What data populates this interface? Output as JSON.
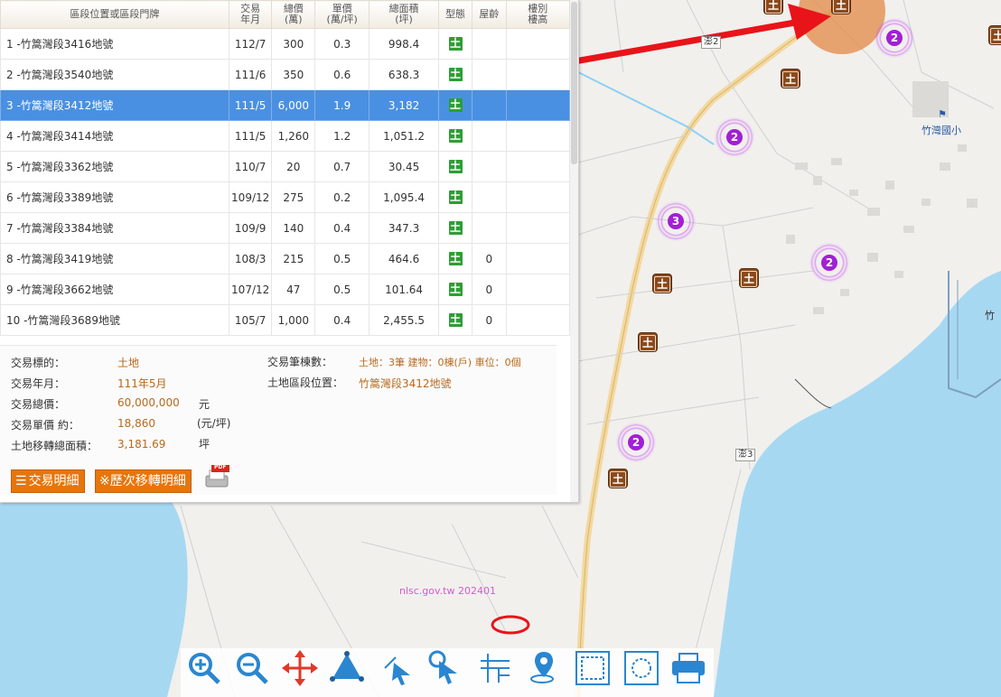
{
  "table": {
    "headers": {
      "address": "區段位置或區段門牌",
      "date_l1": "交易",
      "date_l2": "年月",
      "total_l1": "總價",
      "total_l2": "(萬)",
      "unit_l1": "單價",
      "unit_l2": "(萬/坪)",
      "area_l1": "總面積",
      "area_l2": "(坪)",
      "type": "型態",
      "age": "屋齡",
      "floor_l1": "樓別",
      "floor_l2": "樓高"
    },
    "rows": [
      {
        "address": "1 -竹篙灣段3416地號",
        "date": "112/7",
        "total": "300",
        "unit": "0.3",
        "area": "998.4",
        "type": "土",
        "age": "",
        "floor": ""
      },
      {
        "address": "2 -竹篙灣段3540地號",
        "date": "111/6",
        "total": "350",
        "unit": "0.6",
        "area": "638.3",
        "type": "土",
        "age": "",
        "floor": ""
      },
      {
        "address": "3 -竹篙灣段3412地號",
        "date": "111/5",
        "total": "6,000",
        "unit": "1.9",
        "area": "3,182",
        "type": "土",
        "age": "",
        "floor": ""
      },
      {
        "address": "4 -竹篙灣段3414地號",
        "date": "111/5",
        "total": "1,260",
        "unit": "1.2",
        "area": "1,051.2",
        "type": "土",
        "age": "",
        "floor": ""
      },
      {
        "address": "5 -竹篙灣段3362地號",
        "date": "110/7",
        "total": "20",
        "unit": "0.7",
        "area": "30.45",
        "type": "土",
        "age": "",
        "floor": ""
      },
      {
        "address": "6 -竹篙灣段3389地號",
        "date": "109/12",
        "total": "275",
        "unit": "0.2",
        "area": "1,095.4",
        "type": "土",
        "age": "",
        "floor": ""
      },
      {
        "address": "7 -竹篙灣段3384地號",
        "date": "109/9",
        "total": "140",
        "unit": "0.4",
        "area": "347.3",
        "type": "土",
        "age": "",
        "floor": ""
      },
      {
        "address": "8 -竹篙灣段3419地號",
        "date": "108/3",
        "total": "215",
        "unit": "0.5",
        "area": "464.6",
        "type": "土",
        "age": "0",
        "floor": ""
      },
      {
        "address": "9 -竹篙灣段3662地號",
        "date": "107/12",
        "total": "47",
        "unit": "0.5",
        "area": "101.64",
        "type": "土",
        "age": "0",
        "floor": ""
      },
      {
        "address": "10 -竹篙灣段3689地號",
        "date": "105/7",
        "total": "1,000",
        "unit": "0.4",
        "area": "2,455.5",
        "type": "土",
        "age": "0",
        "floor": ""
      }
    ]
  },
  "details": {
    "target_label": "交易標的：",
    "target_value": "土地",
    "date_label": "交易年月：",
    "date_value": "111年5月",
    "total_label": "交易總價：",
    "total_value": "60,000,000",
    "total_unit": "元",
    "unit_label": "交易單價 約：",
    "unit_value": "18,860",
    "unit_unit": "(元/坪)",
    "area_label": "土地移轉總面積：",
    "area_value": "3,181.69",
    "area_unit": "坪",
    "count_label": "交易筆棟數：",
    "count_value": "土地：3筆 建物：0棟(戶) 車位：0個",
    "location_label": "土地區段位置：",
    "location_value": "竹篙灣段3412地號"
  },
  "buttons": {
    "detail": "交易明細",
    "history": "※歷次移轉明細",
    "pdf_badge": "PDF"
  },
  "map": {
    "watermark": "nlsc.gov.tw 202401",
    "place_label": "竹灣國小",
    "road_label_1": "澎2",
    "road_label_2": "澎3",
    "edge_label": "竹",
    "poi_glyph": "土",
    "clusters": [
      "2",
      "2",
      "3",
      "2",
      "2"
    ]
  },
  "toolbar": {
    "icons": [
      "zoom-in-icon",
      "zoom-out-icon",
      "pan-icon",
      "measure-area-icon",
      "select-icon",
      "identify-icon",
      "parcel-icon",
      "locate-icon",
      "extent-icon",
      "full-extent-icon",
      "print-icon"
    ]
  },
  "colors": {
    "selected_row": "#4a90e2",
    "accent_orange": "#e8750a",
    "value_text": "#b8691b",
    "sea": "#a7d8f2",
    "cluster": "#a21fd6",
    "poi": "#8b4a1c",
    "arrow": "#e8141a"
  }
}
